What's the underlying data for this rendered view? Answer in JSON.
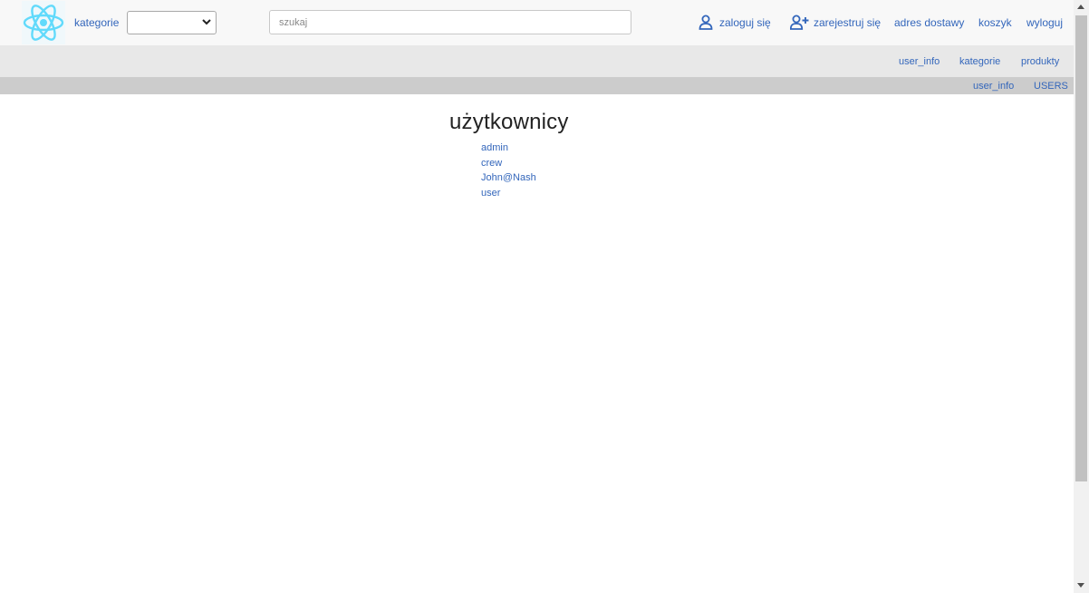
{
  "header": {
    "logo_icon": "react-atom-icon",
    "categories_label": "kategorie",
    "category_select_value": "",
    "search_placeholder": "szukaj",
    "search_value": "",
    "links": {
      "login": "zaloguj się",
      "register": "zarejestruj się",
      "delivery_address": "adres dostawy",
      "cart": "koszyk",
      "logout": "wyloguj"
    },
    "icons": {
      "login": "user-icon",
      "register": "user-plus-icon"
    }
  },
  "subnav": {
    "items": [
      "user_info",
      "kategorie",
      "produkty"
    ]
  },
  "adminnav": {
    "items": [
      "user_info",
      "USERS"
    ]
  },
  "main": {
    "title": "użytkownicy",
    "users": [
      "admin",
      "crew",
      "John@Nash",
      "user"
    ]
  },
  "colors": {
    "link": "#3366bb",
    "react_blue": "#61dafb",
    "topbar_bg": "#f8f8f8",
    "subbar_bg": "#e8e8e8",
    "adminbar_bg": "#cccccc"
  }
}
